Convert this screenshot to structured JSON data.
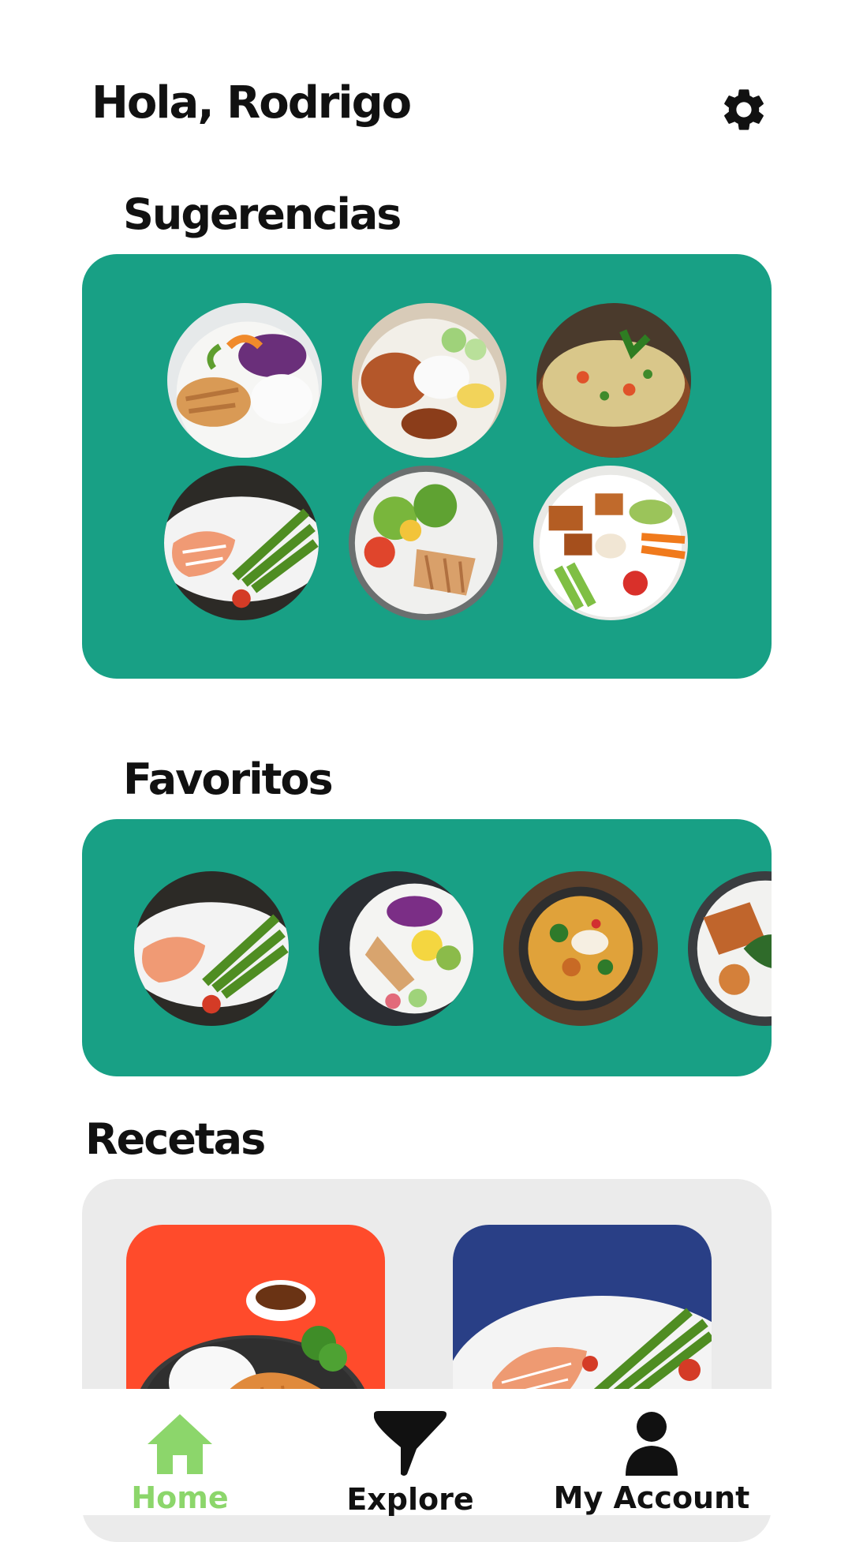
{
  "header": {
    "greeting": "Hola, Rodrigo",
    "settings_icon": "gear-icon"
  },
  "suggestions": {
    "title": "Sugerencias",
    "items": [
      "chicken-rice-salad-plate",
      "chicken-rice-cucumber-plate",
      "quinoa-vegetable-bowl",
      "salmon-asparagus-plate",
      "grilled-chicken-salad",
      "vegetable-tofu-bowl"
    ]
  },
  "favorites": {
    "title": "Favoritos",
    "items": [
      "salmon-asparagus-plate",
      "chicken-guacamole-bowl",
      "curry-bowl",
      "chicken-greens-salad"
    ]
  },
  "recipes": {
    "title": "Recetas",
    "cards": [
      {
        "image": "katsu-rice-plate",
        "background": "#ff4b2b"
      },
      {
        "image": "salmon-asparagus-plate",
        "background": "#293f86"
      }
    ]
  },
  "nav": {
    "active_color": "#8cd66b",
    "items": [
      {
        "label": "Home",
        "icon": "home-icon",
        "active": true
      },
      {
        "label": "Explore",
        "icon": "filter-icon",
        "active": false
      },
      {
        "label": "My Account",
        "icon": "account-icon",
        "active": false
      }
    ]
  },
  "colors": {
    "panel_green": "#18a085",
    "panel_gray": "#ebebeb",
    "text": "#111111"
  }
}
